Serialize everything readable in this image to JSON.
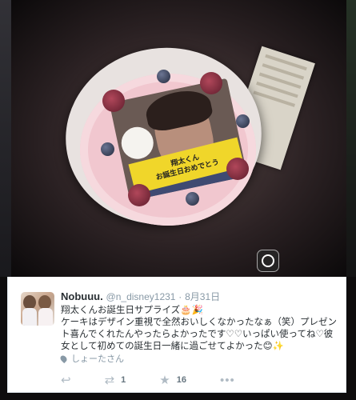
{
  "photo": {
    "banner_line1": "翔太くん",
    "banner_line2": "お誕生日おめでとう"
  },
  "tweet": {
    "name": "Nobuuu.",
    "handle": "@n_disney1231",
    "separator": "·",
    "date": "8月31日",
    "line1": "翔太くんお誕生日サプライズ🎂🎉",
    "line2": "ケーキはデザイン重視で全然おいしくなかったなぁ（笑）プレゼント喜んでくれたんやったらよかったです♡♡いっぱい使ってね♡彼女として初めての誕生日一緒に過ごせてよかった😊✨",
    "location": "しょーたさん",
    "retweet_count": "1",
    "favorite_count": "16",
    "icons": {
      "reply": "reply-icon",
      "retweet": "retweet-icon",
      "favorite": "star-icon",
      "more": "more-icon",
      "location": "location-pin-icon"
    }
  },
  "colors": {
    "text": "#292f33",
    "meta": "#8899a6",
    "border": "#e1e8ed",
    "banner": "#f0d62a"
  }
}
